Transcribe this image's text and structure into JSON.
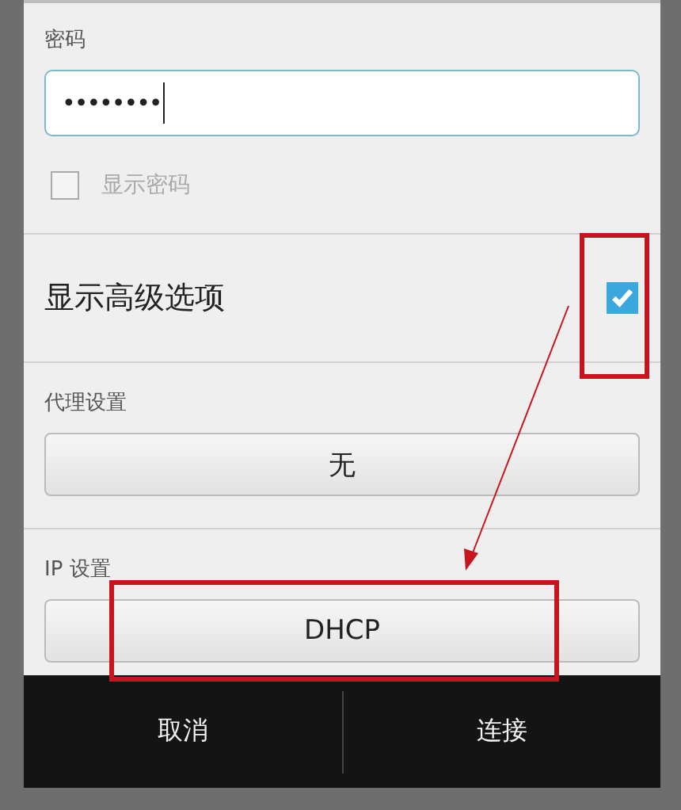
{
  "password": {
    "label": "密码",
    "value": "••••••••"
  },
  "show_password": {
    "label": "显示密码",
    "checked": false
  },
  "advanced_options": {
    "label": "显示高级选项",
    "checked": true
  },
  "proxy": {
    "label": "代理设置",
    "value": "无"
  },
  "ip_settings": {
    "label": "IP 设置",
    "value": "DHCP"
  },
  "buttons": [
    {
      "label": "取消"
    },
    {
      "label": "连接"
    }
  ]
}
